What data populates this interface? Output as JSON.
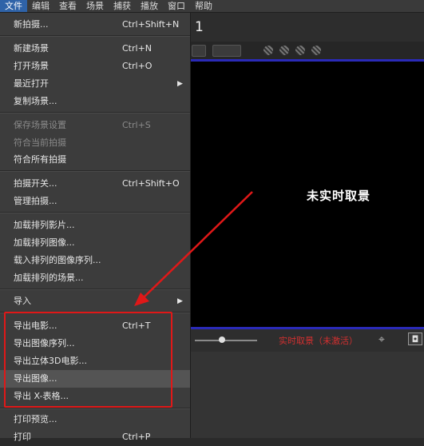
{
  "menubar": {
    "items": [
      "文件",
      "编辑",
      "查看",
      "场景",
      "捕获",
      "播放",
      "窗口",
      "帮助"
    ]
  },
  "capture_title": "1",
  "viewer": {
    "overlay_text": "未实时取景"
  },
  "controls": {
    "status": "实时取景（未激活）"
  },
  "file_menu": {
    "new_capture": {
      "label": "新拍摄...",
      "shortcut": "Ctrl+Shift+N"
    },
    "new_scene": {
      "label": "新建场景",
      "shortcut": "Ctrl+N"
    },
    "open_scene": {
      "label": "打开场景",
      "shortcut": "Ctrl+O"
    },
    "recent": {
      "label": "最近打开"
    },
    "copy_scene": {
      "label": "复制场景..."
    },
    "save_scene_settings": {
      "label": "保存场景设置",
      "shortcut": "Ctrl+S"
    },
    "fit_current": {
      "label": "符合当前拍摄"
    },
    "fit_all": {
      "label": "符合所有拍摄"
    },
    "capture_switch": {
      "label": "拍摄开关...",
      "shortcut": "Ctrl+Shift+O"
    },
    "manage_captures": {
      "label": "管理拍摄..."
    },
    "load_seq_video": {
      "label": "加载排列影片..."
    },
    "load_seq_image": {
      "label": "加载排列图像..."
    },
    "load_image_sequence": {
      "label": "载入排列的图像序列..."
    },
    "load_seq_scene": {
      "label": "加载排列的场景..."
    },
    "import": {
      "label": "导入"
    },
    "export_movie": {
      "label": "导出电影...",
      "shortcut": "Ctrl+T"
    },
    "export_image_sequence": {
      "label": "导出图像序列..."
    },
    "export_3d_movie": {
      "label": "导出立体3D电影..."
    },
    "export_image": {
      "label": "导出图像..."
    },
    "export_x_sheet": {
      "label": "导出 X-表格..."
    },
    "print_preview": {
      "label": "打印预览..."
    },
    "print": {
      "label": "打印",
      "shortcut": "Ctrl+P"
    }
  }
}
